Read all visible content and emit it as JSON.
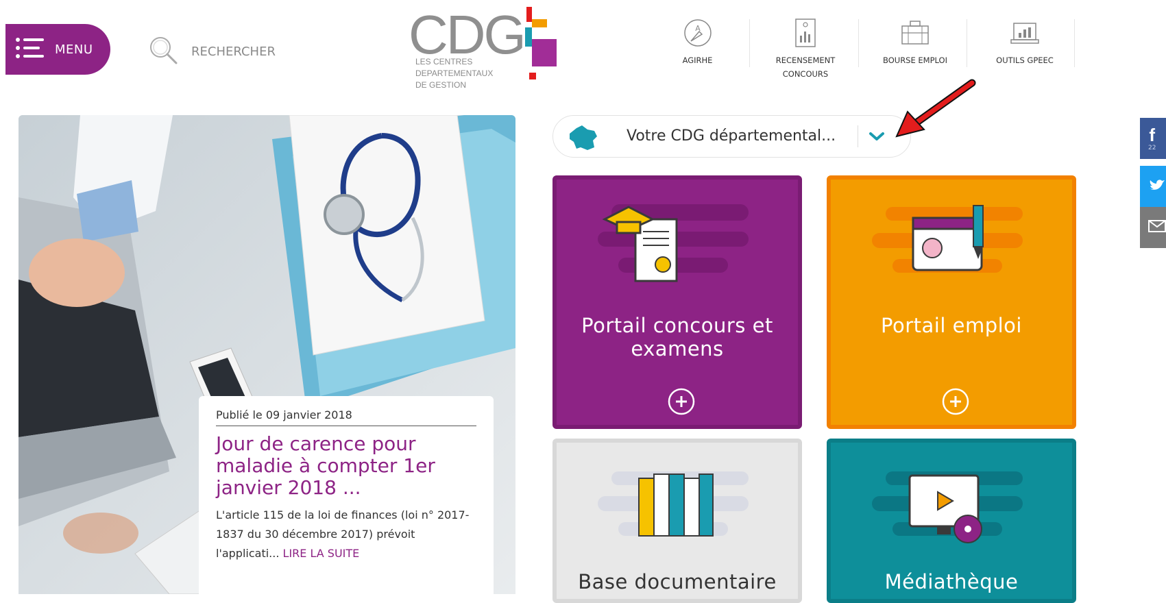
{
  "header": {
    "menu_label": "MENU",
    "search_label": "RECHERCHER",
    "logo": {
      "text": "CDG",
      "subtitle_lines": [
        "LES CENTRES",
        "DEPARTEMENTAUX",
        "DE GESTION"
      ]
    },
    "quick_links": [
      {
        "label_line1": "AGIRHE",
        "label_line2": "",
        "icon": "compass-icon"
      },
      {
        "label_line1": "RECENSEMENT",
        "label_line2": "CONCOURS",
        "icon": "report-icon"
      },
      {
        "label_line1": "BOURSE EMPLOI",
        "label_line2": "",
        "icon": "briefcase-icon"
      },
      {
        "label_line1": "OUTILS GPEEC",
        "label_line2": "",
        "icon": "laptop-chart-icon"
      }
    ]
  },
  "news": {
    "date": "Publié le 09 janvier 2018",
    "title": "Jour de carence pour maladie à compter 1er janvier 2018 ...",
    "excerpt": "L'article 115 de la loi de finances (loi n° 2017-1837 du 30 décembre 2017) prévoit l'applicati...",
    "read_more": "LIRE LA SUITE"
  },
  "dept_selector": {
    "placeholder": "Votre CDG départemental...",
    "icon": "france-map-icon"
  },
  "tiles": [
    {
      "label": "Portail concours et examens",
      "color": "#8d2385",
      "border": "#7a1c73",
      "icon": "graduation-diploma-icon"
    },
    {
      "label": "Portail emploi",
      "color": "#f39c00",
      "border": "#f28100",
      "icon": "profile-pen-icon"
    },
    {
      "label": "Base documentaire",
      "color": "#e8e8e8",
      "border": "#d8d8d8",
      "icon": "books-icon"
    },
    {
      "label": "Médiathèque",
      "color": "#0e8f9a",
      "border": "#0b7e88",
      "icon": "video-monitor-icon"
    }
  ],
  "social": {
    "facebook_count": "22",
    "colors": {
      "facebook": "#3b5998",
      "twitter": "#1da1f2",
      "email": "#7a7a7a"
    }
  },
  "colors": {
    "brand_purple": "#8d2385",
    "accent_teal": "#1a9cb0",
    "annotation_red": "#e31d1d"
  }
}
